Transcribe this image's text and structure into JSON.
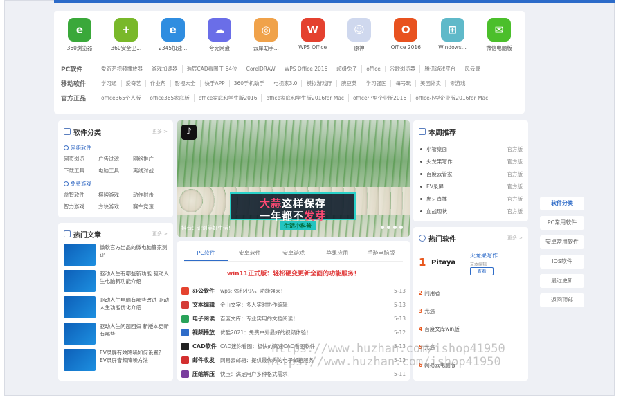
{
  "apps": [
    {
      "name": "360浏览器",
      "icon": "e",
      "color": "#3aa83a"
    },
    {
      "name": "360安全卫...",
      "icon": "+",
      "color": "#79b82a"
    },
    {
      "name": "2345加速...",
      "icon": "e",
      "color": "#2f8de0"
    },
    {
      "name": "夸克网盘",
      "icon": "☁",
      "color": "#6a6ee8"
    },
    {
      "name": "云犀助手...",
      "icon": "◎",
      "color": "#f0a24a"
    },
    {
      "name": "WPS Office",
      "icon": "W",
      "color": "#e4412f"
    },
    {
      "name": "原神",
      "icon": "☺",
      "color": "#cfd8ee"
    },
    {
      "name": "Office 2016",
      "icon": "O",
      "color": "#e8521f"
    },
    {
      "name": "Windows...",
      "icon": "⊞",
      "color": "#5fb9c9"
    },
    {
      "name": "微信电脑版",
      "icon": "✉",
      "color": "#4bbf2b"
    }
  ],
  "category_rows": [
    {
      "label": "PC软件",
      "items": [
        "爱奇艺视频播放器",
        "游戏加速器",
        "浩辰CAD看图王 64位",
        "CorelDRAW",
        "WPS Office 2016",
        "超级兔子",
        "office",
        "谷歌浏览器",
        "腾讯游戏平台",
        "风云录"
      ]
    },
    {
      "label": "移动软件",
      "items": [
        "学习通",
        "爱奇艺",
        "作业帮",
        "影视大全",
        "快手APP",
        "360手机助手",
        "电视家3.0",
        "模拟游戏厅",
        "腕豆荚",
        "学习强国",
        "每号玩",
        "美团外卖",
        "零游戏"
      ]
    },
    {
      "label": "官方正品",
      "items": [
        "office365个人版",
        "office365家庭版",
        "office家庭和学生版2016",
        "office家庭和学生版2016for Mac",
        "office小型企业版2016",
        "office小型企业版2016for Mac"
      ]
    }
  ],
  "software_category": {
    "title": "软件分类",
    "more": "更多 >",
    "group1": "网络软件",
    "group1_items": [
      "网页浏览",
      "广告过滤",
      "网络推广",
      "下载工具",
      "电脑工具",
      "离线对战"
    ],
    "group2": "免费游戏",
    "group2_items": [
      "益智软件",
      "棋牌游戏",
      "动作射击",
      "智力游戏",
      "方块游戏",
      "赛车竞速"
    ]
  },
  "hot_articles": {
    "title": "热门文章",
    "more": "更多 >",
    "items": [
      "微软官方出品的微电脑管家测评",
      "驱动人生有哪些新功能 驱动人生电脑新功能介绍",
      "驱动人生电脑有哪些改进 驱动人生功能优化介绍",
      "驱动人生问题回归 新版本更新有哪些",
      "EV录屏有效降噪如何设置？EV录屏音频降噪方法"
    ]
  },
  "banner": {
    "caption_line1_a": "大蒜",
    "caption_line1_b": "这样保存",
    "caption_line2_a": "一年都不",
    "caption_line2_b": "发芽",
    "tagline": "生活小科普",
    "subtitle": "抖音：识别美好生活！"
  },
  "software_list": {
    "tabs": [
      "PC软件",
      "安卓软件",
      "安卓游戏",
      "苹果应用",
      "手游电脑版"
    ],
    "active_tab": 0,
    "promo": "win11正式版：轻松硬变更新全面的功能服务！",
    "rows": [
      {
        "cat": "办公软件",
        "desc": "wps: 体积小巧，功能强大！",
        "date": "5-13",
        "color": "#e5432f"
      },
      {
        "cat": "文本编辑",
        "desc": "金山文字：多人实时协作编辑！",
        "date": "5-13",
        "color": "#d43b36"
      },
      {
        "cat": "电子阅读",
        "desc": "百度文库：专业实用的文档阅读！",
        "date": "5-13",
        "color": "#2aa35a"
      },
      {
        "cat": "视频播放",
        "desc": "优酷2021：免费户外最好的视频体验！",
        "date": "5-12",
        "color": "#2f6cc8"
      },
      {
        "cat": "CAD软件",
        "desc": "CAD迷你看图：极快的高速CAD看图软件",
        "date": "5-13",
        "color": "#222222"
      },
      {
        "cat": "邮件收发",
        "desc": "网易云邮箱：提供最优秀的电子邮箱服务",
        "date": "5-13",
        "color": "#d32f2f"
      },
      {
        "cat": "压缩解压",
        "desc": "快压：满足用户多种格式需求！",
        "date": "5-11",
        "color": "#7a3e9e"
      }
    ]
  },
  "weekly": {
    "title": "本周推荐",
    "items": [
      {
        "name": "小智桌面",
        "tag": "官方版"
      },
      {
        "name": "火龙果写作",
        "tag": "官方版"
      },
      {
        "name": "百度云管家",
        "tag": "官方版"
      },
      {
        "name": "EV录屏",
        "tag": "官方版"
      },
      {
        "name": "虎牙直播",
        "tag": "官方版"
      },
      {
        "name": "血战现状",
        "tag": "官方版"
      }
    ]
  },
  "hot_software": {
    "title": "热门软件",
    "more": "更多 >",
    "first": {
      "rank": "1",
      "logo": "Pitaya",
      "name": "火龙果写作",
      "size": "文本编辑",
      "button": "查看"
    },
    "items": [
      {
        "rank": "2",
        "name": "闪用者"
      },
      {
        "rank": "3",
        "name": "光遇"
      },
      {
        "rank": "4",
        "name": "百度文库win版"
      },
      {
        "rank": "5",
        "name": "光遇"
      },
      {
        "rank": "6",
        "name": "网易云电脑版"
      }
    ]
  },
  "float_nav": [
    "软件分类",
    "PC常用软件",
    "安卓常用软件",
    "IOS软件",
    "最近更新",
    "返回顶部"
  ],
  "watermark": "https://www.huzhan.com/ishop41950"
}
